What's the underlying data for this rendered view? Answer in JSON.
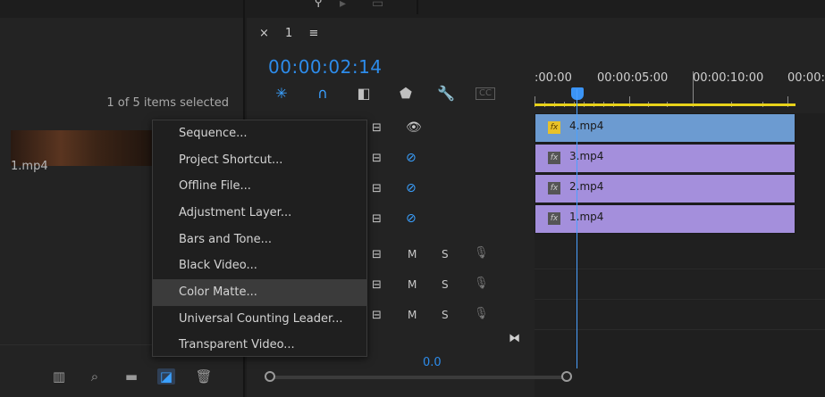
{
  "project": {
    "selection_status": "1 of 5 items selected",
    "clip_name": "1.mp4"
  },
  "sequence": {
    "tab_close": "×",
    "tab_name": "1",
    "tab_menu": "≡",
    "timecode": "00:00:02:14"
  },
  "ruler": {
    "labels": [
      ":00:00",
      "00:00:05:00",
      "00:00:10:00",
      "00:00:"
    ]
  },
  "tracks": {
    "video": [
      {
        "clip": "4.mp4",
        "fx": "fx",
        "color": "#6c9bd1",
        "eye": "visible"
      },
      {
        "clip": "3.mp4",
        "fx": "fx",
        "color": "#a48fdc",
        "eye": "hidden"
      },
      {
        "clip": "2.mp4",
        "fx": "fx",
        "color": "#a48fdc",
        "eye": "hidden"
      },
      {
        "clip": "1.mp4",
        "fx": "fx",
        "color": "#a48fdc",
        "eye": "hidden"
      }
    ],
    "audio": [
      {
        "m": "M",
        "s": "S"
      },
      {
        "m": "M",
        "s": "S"
      },
      {
        "m": "M",
        "s": "S"
      }
    ],
    "master_volume": "0.0"
  },
  "new_item_menu": {
    "items": [
      "Sequence...",
      "Project Shortcut...",
      "Offline File...",
      "Adjustment Layer...",
      "Bars and Tone...",
      "Black Video...",
      "Color Matte...",
      "Universal Counting Leader...",
      "Transparent Video..."
    ],
    "highlighted": "Color Matte..."
  },
  "colors": {
    "accent": "#2d8ceb",
    "playhead": "#4aa0ff",
    "work_area": "#e8d21a"
  }
}
